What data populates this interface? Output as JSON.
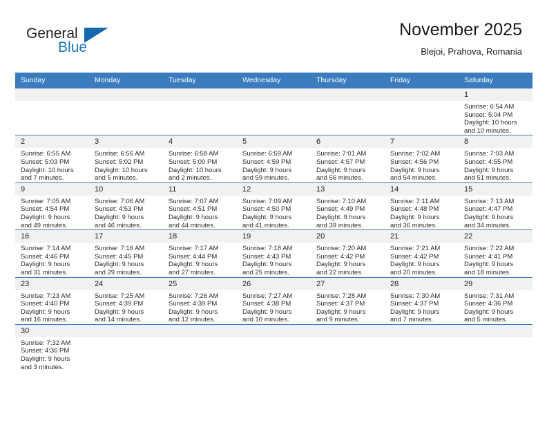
{
  "brand": {
    "word1": "General",
    "word2": "Blue",
    "mark": "triangle-logo"
  },
  "header": {
    "title": "November 2025",
    "subtitle": "Blejoi, Prahova, Romania"
  },
  "weekdays": [
    "Sunday",
    "Monday",
    "Tuesday",
    "Wednesday",
    "Thursday",
    "Friday",
    "Saturday"
  ],
  "labels": {
    "sunrise": "Sunrise:",
    "sunset": "Sunset:",
    "daylight": "Daylight:"
  },
  "colors": {
    "header_blue": "#3b7cbf",
    "brand_blue": "#1878be",
    "daynum_bg": "#f1f1f1",
    "text": "#2b2b2b"
  },
  "weeks": [
    [
      {
        "blank": true
      },
      {
        "blank": true
      },
      {
        "blank": true
      },
      {
        "blank": true
      },
      {
        "blank": true
      },
      {
        "blank": true
      },
      {
        "day": "1",
        "sunrise": "Sunrise: 6:54 AM",
        "sunset": "Sunset: 5:04 PM",
        "daylight1": "Daylight: 10 hours",
        "daylight2": "and 10 minutes."
      }
    ],
    [
      {
        "day": "2",
        "sunrise": "Sunrise: 6:55 AM",
        "sunset": "Sunset: 5:03 PM",
        "daylight1": "Daylight: 10 hours",
        "daylight2": "and 7 minutes."
      },
      {
        "day": "3",
        "sunrise": "Sunrise: 6:56 AM",
        "sunset": "Sunset: 5:02 PM",
        "daylight1": "Daylight: 10 hours",
        "daylight2": "and 5 minutes."
      },
      {
        "day": "4",
        "sunrise": "Sunrise: 6:58 AM",
        "sunset": "Sunset: 5:00 PM",
        "daylight1": "Daylight: 10 hours",
        "daylight2": "and 2 minutes."
      },
      {
        "day": "5",
        "sunrise": "Sunrise: 6:59 AM",
        "sunset": "Sunset: 4:59 PM",
        "daylight1": "Daylight: 9 hours",
        "daylight2": "and 59 minutes."
      },
      {
        "day": "6",
        "sunrise": "Sunrise: 7:01 AM",
        "sunset": "Sunset: 4:57 PM",
        "daylight1": "Daylight: 9 hours",
        "daylight2": "and 56 minutes."
      },
      {
        "day": "7",
        "sunrise": "Sunrise: 7:02 AM",
        "sunset": "Sunset: 4:56 PM",
        "daylight1": "Daylight: 9 hours",
        "daylight2": "and 54 minutes."
      },
      {
        "day": "8",
        "sunrise": "Sunrise: 7:03 AM",
        "sunset": "Sunset: 4:55 PM",
        "daylight1": "Daylight: 9 hours",
        "daylight2": "and 51 minutes."
      }
    ],
    [
      {
        "day": "9",
        "sunrise": "Sunrise: 7:05 AM",
        "sunset": "Sunset: 4:54 PM",
        "daylight1": "Daylight: 9 hours",
        "daylight2": "and 49 minutes."
      },
      {
        "day": "10",
        "sunrise": "Sunrise: 7:06 AM",
        "sunset": "Sunset: 4:53 PM",
        "daylight1": "Daylight: 9 hours",
        "daylight2": "and 46 minutes."
      },
      {
        "day": "11",
        "sunrise": "Sunrise: 7:07 AM",
        "sunset": "Sunset: 4:51 PM",
        "daylight1": "Daylight: 9 hours",
        "daylight2": "and 44 minutes."
      },
      {
        "day": "12",
        "sunrise": "Sunrise: 7:09 AM",
        "sunset": "Sunset: 4:50 PM",
        "daylight1": "Daylight: 9 hours",
        "daylight2": "and 41 minutes."
      },
      {
        "day": "13",
        "sunrise": "Sunrise: 7:10 AM",
        "sunset": "Sunset: 4:49 PM",
        "daylight1": "Daylight: 9 hours",
        "daylight2": "and 39 minutes."
      },
      {
        "day": "14",
        "sunrise": "Sunrise: 7:11 AM",
        "sunset": "Sunset: 4:48 PM",
        "daylight1": "Daylight: 9 hours",
        "daylight2": "and 36 minutes."
      },
      {
        "day": "15",
        "sunrise": "Sunrise: 7:13 AM",
        "sunset": "Sunset: 4:47 PM",
        "daylight1": "Daylight: 9 hours",
        "daylight2": "and 34 minutes."
      }
    ],
    [
      {
        "day": "16",
        "sunrise": "Sunrise: 7:14 AM",
        "sunset": "Sunset: 4:46 PM",
        "daylight1": "Daylight: 9 hours",
        "daylight2": "and 31 minutes."
      },
      {
        "day": "17",
        "sunrise": "Sunrise: 7:16 AM",
        "sunset": "Sunset: 4:45 PM",
        "daylight1": "Daylight: 9 hours",
        "daylight2": "and 29 minutes."
      },
      {
        "day": "18",
        "sunrise": "Sunrise: 7:17 AM",
        "sunset": "Sunset: 4:44 PM",
        "daylight1": "Daylight: 9 hours",
        "daylight2": "and 27 minutes."
      },
      {
        "day": "19",
        "sunrise": "Sunrise: 7:18 AM",
        "sunset": "Sunset: 4:43 PM",
        "daylight1": "Daylight: 9 hours",
        "daylight2": "and 25 minutes."
      },
      {
        "day": "20",
        "sunrise": "Sunrise: 7:20 AM",
        "sunset": "Sunset: 4:42 PM",
        "daylight1": "Daylight: 9 hours",
        "daylight2": "and 22 minutes."
      },
      {
        "day": "21",
        "sunrise": "Sunrise: 7:21 AM",
        "sunset": "Sunset: 4:42 PM",
        "daylight1": "Daylight: 9 hours",
        "daylight2": "and 20 minutes."
      },
      {
        "day": "22",
        "sunrise": "Sunrise: 7:22 AM",
        "sunset": "Sunset: 4:41 PM",
        "daylight1": "Daylight: 9 hours",
        "daylight2": "and 18 minutes."
      }
    ],
    [
      {
        "day": "23",
        "sunrise": "Sunrise: 7:23 AM",
        "sunset": "Sunset: 4:40 PM",
        "daylight1": "Daylight: 9 hours",
        "daylight2": "and 16 minutes."
      },
      {
        "day": "24",
        "sunrise": "Sunrise: 7:25 AM",
        "sunset": "Sunset: 4:39 PM",
        "daylight1": "Daylight: 9 hours",
        "daylight2": "and 14 minutes."
      },
      {
        "day": "25",
        "sunrise": "Sunrise: 7:26 AM",
        "sunset": "Sunset: 4:39 PM",
        "daylight1": "Daylight: 9 hours",
        "daylight2": "and 12 minutes."
      },
      {
        "day": "26",
        "sunrise": "Sunrise: 7:27 AM",
        "sunset": "Sunset: 4:38 PM",
        "daylight1": "Daylight: 9 hours",
        "daylight2": "and 10 minutes."
      },
      {
        "day": "27",
        "sunrise": "Sunrise: 7:28 AM",
        "sunset": "Sunset: 4:37 PM",
        "daylight1": "Daylight: 9 hours",
        "daylight2": "and 9 minutes."
      },
      {
        "day": "28",
        "sunrise": "Sunrise: 7:30 AM",
        "sunset": "Sunset: 4:37 PM",
        "daylight1": "Daylight: 9 hours",
        "daylight2": "and 7 minutes."
      },
      {
        "day": "29",
        "sunrise": "Sunrise: 7:31 AM",
        "sunset": "Sunset: 4:36 PM",
        "daylight1": "Daylight: 9 hours",
        "daylight2": "and 5 minutes."
      }
    ],
    [
      {
        "day": "30",
        "sunrise": "Sunrise: 7:32 AM",
        "sunset": "Sunset: 4:36 PM",
        "daylight1": "Daylight: 9 hours",
        "daylight2": "and 3 minutes."
      },
      {
        "blank": true
      },
      {
        "blank": true
      },
      {
        "blank": true
      },
      {
        "blank": true
      },
      {
        "blank": true
      },
      {
        "blank": true
      }
    ]
  ]
}
